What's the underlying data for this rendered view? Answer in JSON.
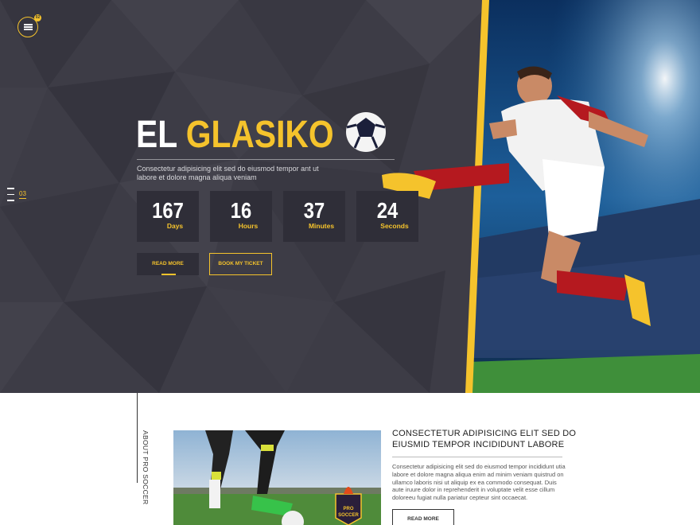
{
  "header": {
    "menu_badge": "02",
    "menu_icon": "hamburger-icon"
  },
  "hero": {
    "title_part1": "EL",
    "title_part2": "GLASIKO",
    "description": "Consectetur adipisicing elit sed do eiusmod tempor ant ut labore et dolore magna aliqua veniam",
    "slide_number": "03",
    "countdown": [
      {
        "value": "167",
        "label": "Days"
      },
      {
        "value": "16",
        "label": "Hours"
      },
      {
        "value": "37",
        "label": "Minutes"
      },
      {
        "value": "24",
        "label": "Seconds"
      }
    ],
    "read_more_label": "READ MORE",
    "ticket_label": "BOOK MY TICKET"
  },
  "about": {
    "side_label": "ABOUT PRO SOCCER",
    "heading": "CONSECTETUR ADIPISICING ELIT SED DO EIUSMID TEMPOR INCIDIDUNT LABORE",
    "body": "Consectetur adipisicing elit sed do eiusmod tempor incididunt utia labore et dolore magna aliqua enim ad minim veniam quistrud on ullamco laboris nisi ut aliquip ex ea commodo consequat. Duis aute iruure dolor in reprehenderit in voluptate velit esse cillum doloreeu fugiat nulla pariatur cepteur sint occaecat.",
    "read_more_label": "READ MORE",
    "logo_text": "PRO SOCCER"
  },
  "colors": {
    "accent": "#f5c32c",
    "dark": "#3c3b45",
    "panel": "#2f2e38"
  }
}
